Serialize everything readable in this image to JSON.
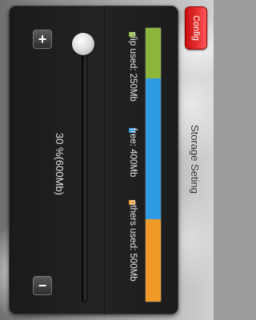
{
  "header": {
    "title": "Storage Seting",
    "config_label": "Config"
  },
  "slider": {
    "increase_label": "+",
    "decrease_label": "−",
    "value_label": "30 %(600Mb)",
    "percent": 30
  },
  "legend": [
    {
      "label": "clip used: 250Mb",
      "color": "#8db63c"
    },
    {
      "label": "free: 400Mb",
      "color": "#2f9be3"
    },
    {
      "label": "others used: 500Mb",
      "color": "#f09a2a"
    }
  ],
  "storage_bar": {
    "segments": [
      {
        "name": "clip",
        "color": "#8db63c",
        "fraction": 0.185
      },
      {
        "name": "free",
        "color": "#2f9be3",
        "fraction": 0.515
      },
      {
        "name": "others",
        "color": "#f09a2a",
        "fraction": 0.3
      }
    ]
  }
}
